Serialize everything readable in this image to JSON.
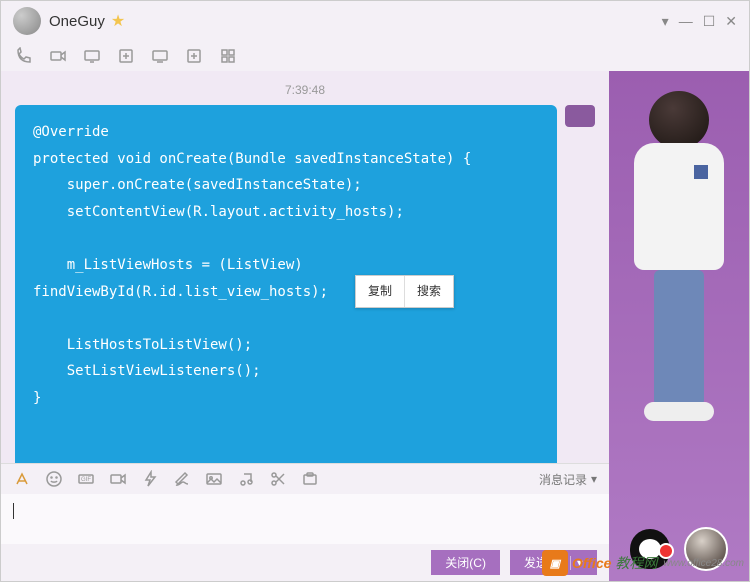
{
  "header": {
    "title": "OneGuy"
  },
  "window_controls": {
    "dropdown": "▾",
    "minimize": "—",
    "maximize": "☐",
    "close": "✕"
  },
  "chat": {
    "timestamp": "7:39:48",
    "code": "@Override\nprotected void onCreate(Bundle savedInstanceState) {\n    super.onCreate(savedInstanceState);\n    setContentView(R.layout.activity_hosts);\n\n    m_ListViewHosts = (ListView) findViewById(R.id.list_view_hosts);\n\n    ListHostsToListView();\n    SetListViewListeners();\n}"
  },
  "context_menu": {
    "copy": "复制",
    "search": "搜索"
  },
  "input_bar": {
    "history": "消息记录"
  },
  "buttons": {
    "close": "关闭(C)",
    "send": "发送(S)"
  },
  "watermark": {
    "brand1": "Office",
    "brand2": "教程网",
    "url": "www.office28.com"
  }
}
